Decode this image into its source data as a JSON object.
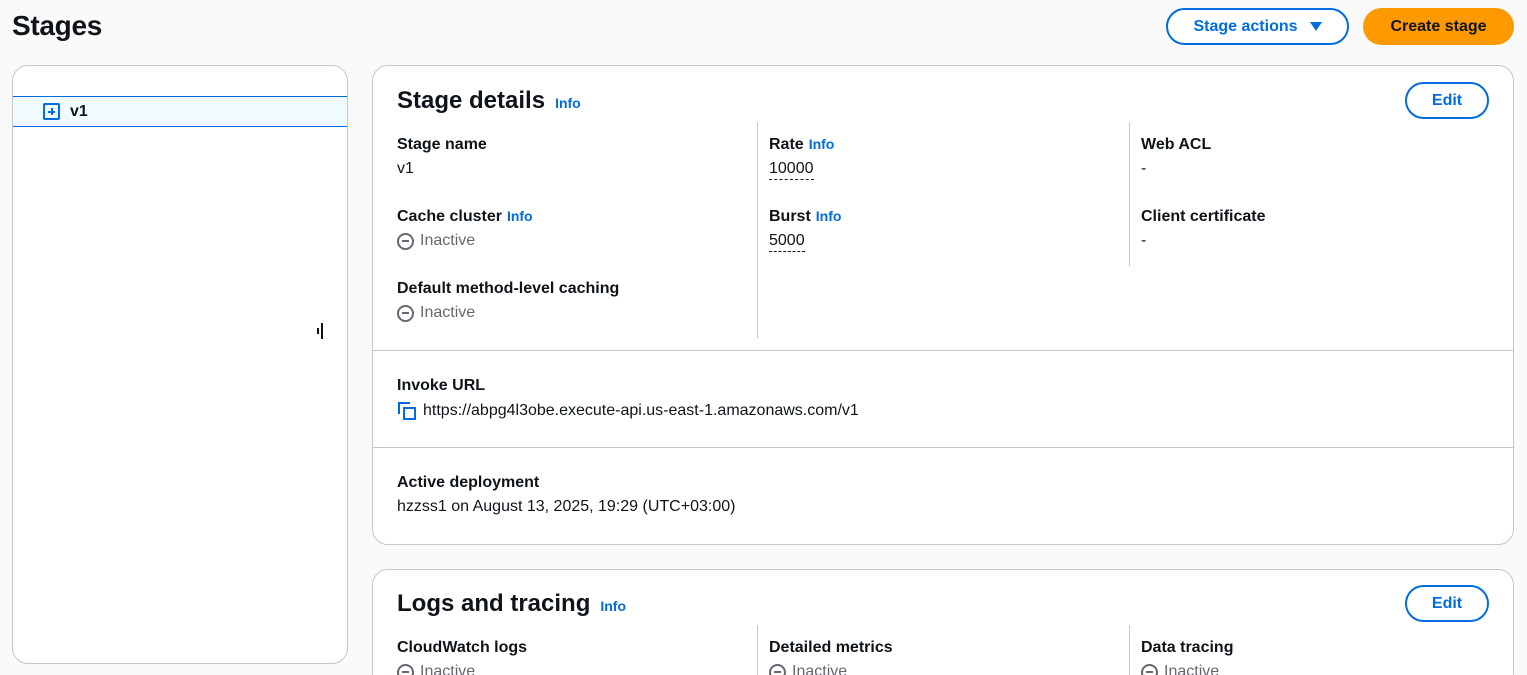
{
  "header": {
    "title": "Stages",
    "stage_actions_label": "Stage actions",
    "create_stage_label": "Create stage"
  },
  "tree": {
    "items": [
      {
        "label": "v1"
      }
    ]
  },
  "stage_details": {
    "title": "Stage details",
    "info_label": "Info",
    "edit_label": "Edit",
    "stage_name": {
      "label": "Stage name",
      "value": "v1"
    },
    "cache_cluster": {
      "label": "Cache cluster",
      "info": "Info",
      "value": "Inactive"
    },
    "default_caching": {
      "label": "Default method-level caching",
      "value": "Inactive"
    },
    "rate": {
      "label": "Rate",
      "info": "Info",
      "value": "10000"
    },
    "burst": {
      "label": "Burst",
      "info": "Info",
      "value": "5000"
    },
    "web_acl": {
      "label": "Web ACL",
      "value": "-"
    },
    "client_certificate": {
      "label": "Client certificate",
      "value": "-"
    },
    "invoke_url": {
      "label": "Invoke URL",
      "value": "https://abpg4l3obe.execute-api.us-east-1.amazonaws.com/v1"
    },
    "active_deployment": {
      "label": "Active deployment",
      "value": "hzzss1 on August 13, 2025, 19:29 (UTC+03:00)"
    }
  },
  "logs_tracing": {
    "title": "Logs and tracing",
    "info_label": "Info",
    "edit_label": "Edit",
    "cloudwatch_logs": {
      "label": "CloudWatch logs",
      "value": "Inactive"
    },
    "detailed_metrics": {
      "label": "Detailed metrics",
      "value": "Inactive"
    },
    "data_tracing": {
      "label": "Data tracing",
      "value": "Inactive"
    }
  },
  "icons": {
    "expand": "plus-square-icon",
    "status": "minus-circle-icon",
    "copy": "copy-icon",
    "caret": "caret-down-icon"
  },
  "colors": {
    "accent": "#006ce0",
    "primary_button": "#ff9900",
    "muted_text": "#656871",
    "border": "#c6c6cd"
  }
}
